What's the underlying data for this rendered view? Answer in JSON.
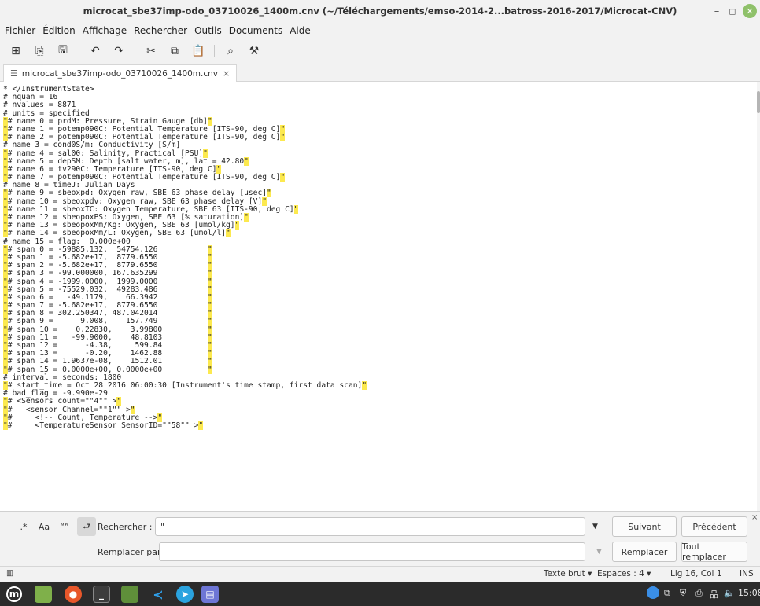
{
  "window": {
    "title": "microcat_sbe37imp-odo_03710026_1400m.cnv (~/Téléchargements/emso-2014-2...batross-2016-2017/Microcat-CNV)"
  },
  "menu": [
    "Fichier",
    "Édition",
    "Affichage",
    "Rechercher",
    "Outils",
    "Documents",
    "Aide"
  ],
  "tab": {
    "label": "microcat_sbe37imp-odo_03710026_1400m.cnv",
    "close": "×"
  },
  "editor": {
    "lines": [
      {
        "t": "* </InstrumentState>",
        "q": 0
      },
      {
        "t": "# nquan = 16",
        "q": 0
      },
      {
        "t": "# nvalues = 8871",
        "q": 0
      },
      {
        "t": "# units = specified",
        "q": 0
      },
      {
        "t": "# name 0 = prdM: Pressure, Strain Gauge [db]",
        "q": 1
      },
      {
        "t": "# name 1 = potemp090C: Potential Temperature [ITS-90, deg C]",
        "q": 1
      },
      {
        "t": "# name 2 = potemp090C: Potential Temperature [ITS-90, deg C]",
        "q": 1
      },
      {
        "t": "# name 3 = cond0S/m: Conductivity [S/m]",
        "q": 0
      },
      {
        "t": "# name 4 = sal00: Salinity, Practical [PSU]",
        "q": 1
      },
      {
        "t": "# name 5 = depSM: Depth [salt water, m], lat = 42.80",
        "q": 1
      },
      {
        "t": "# name 6 = tv290C: Temperature [ITS-90, deg C]",
        "q": 1
      },
      {
        "t": "# name 7 = potemp090C: Potential Temperature [ITS-90, deg C]",
        "q": 1
      },
      {
        "t": "# name 8 = timeJ: Julian Days",
        "q": 0
      },
      {
        "t": "# name 9 = sbeoxpd: Oxygen raw, SBE 63 phase delay [usec]",
        "q": 1
      },
      {
        "t": "# name 10 = sbeoxpdv: Oxygen raw, SBE 63 phase delay [V]",
        "q": 1
      },
      {
        "t": "# name 11 = sbeoxTC: Oxygen Temperature, SBE 63 [ITS-90, deg C]",
        "q": 1
      },
      {
        "t": "# name 12 = sbeopoxPS: Oxygen, SBE 63 [% saturation]",
        "q": 1
      },
      {
        "t": "# name 13 = sbeopoxMm/Kg: Oxygen, SBE 63 [umol/kg]",
        "q": 1
      },
      {
        "t": "# name 14 = sbeopoxMm/L: Oxygen, SBE 63 [umol/l]",
        "q": 1
      },
      {
        "t": "# name 15 = flag:  0.000e+00",
        "q": 0
      },
      {
        "t": "# span 0 = -59885.132,  54754.126",
        "q": 2
      },
      {
        "t": "# span 1 = -5.682e+17,  8779.6550",
        "q": 2
      },
      {
        "t": "# span 2 = -5.682e+17,  8779.6550",
        "q": 2
      },
      {
        "t": "# span 3 = -99.000000, 167.635299",
        "q": 2
      },
      {
        "t": "# span 4 = -1999.0000,  1999.0000",
        "q": 2
      },
      {
        "t": "# span 5 = -75529.032,  49283.486",
        "q": 2
      },
      {
        "t": "# span 6 =   -49.1179,    66.3942",
        "q": 2
      },
      {
        "t": "# span 7 = -5.682e+17,  8779.6550",
        "q": 2
      },
      {
        "t": "# span 8 = 302.250347, 487.042014",
        "q": 2
      },
      {
        "t": "# span 9 =      9.008,    157.749",
        "q": 2
      },
      {
        "t": "# span 10 =    0.22830,    3.99800",
        "q": 2
      },
      {
        "t": "# span 11 =   -99.9000,    48.8103",
        "q": 2
      },
      {
        "t": "# span 12 =      -4.38,     599.84",
        "q": 2
      },
      {
        "t": "# span 13 =      -0.20,    1462.88",
        "q": 2
      },
      {
        "t": "# span 14 = 1.9637e-08,    1512.01",
        "q": 2
      },
      {
        "t": "# span 15 = 0.0000e+00, 0.0000e+00",
        "q": 2
      },
      {
        "t": "# interval = seconds: 1800",
        "q": 0
      },
      {
        "t": "# start_time = Oct 28 2016 06:00:30 [Instrument's time stamp, first data scan]",
        "q": 1
      },
      {
        "t": "# bad_flag = -9.990e-29",
        "q": 0
      },
      {
        "t": "# <Sensors count=\"\"4\"\" >",
        "q": 3
      },
      {
        "t": "#   <sensor Channel=\"\"1\"\" >",
        "q": 3
      },
      {
        "t": "#     <!-- Count, Temperature -->",
        "q": 1
      },
      {
        "t": "#     <TemperatureSensor SensorID=\"\"58\"\" >",
        "q": 3
      }
    ]
  },
  "search": {
    "regex_label": ".*",
    "case_label": "Aa",
    "word_label": "“”",
    "find_label": "Rechercher :",
    "find_value": "\"",
    "replace_label": "Remplacer par :",
    "replace_value": "",
    "next_label": "Suivant",
    "prev_label": "Précédent",
    "replace_btn": "Remplacer",
    "replace_all_btn": "Tout remplacer",
    "close": "×"
  },
  "status": {
    "mode": "Texte brut ▾",
    "spaces": "Espaces : 4 ▾",
    "position": "Lig 16, Col 1",
    "ins": "INS"
  },
  "taskbar": {
    "clock": "15:08"
  },
  "colors": {
    "highlight": "#fce94f",
    "panel_bg": "#f2f2f2",
    "taskbar_bg": "#2b2b2b"
  }
}
